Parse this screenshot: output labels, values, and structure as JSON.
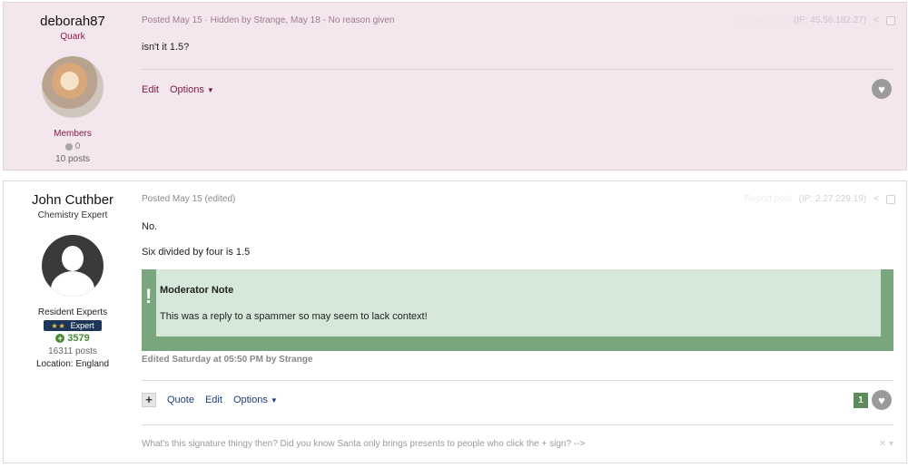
{
  "post1": {
    "author": "deborah87",
    "title": "Quark",
    "group": "Members",
    "reputation": "0",
    "post_count": "10 posts",
    "meta": "Posted May 15 · Hidden by Strange, May 18 - No reason given",
    "report_label": "Report post",
    "ip": "(IP: 45.56.182.27)",
    "body": "isn't it 1.5?",
    "edit_label": "Edit",
    "options_label": "Options"
  },
  "post2": {
    "author": "John Cuthber",
    "title": "Chemistry Expert",
    "group": "Resident Experts",
    "badge": "Expert",
    "reputation": "3579",
    "post_count": "16311 posts",
    "location": "Location: England",
    "meta": "Posted May 15 (edited)",
    "report_label": "Report post",
    "ip": "(IP: 2.27.229.19)",
    "body_line1": "No.",
    "body_line2": "Six divided by four is 1.5",
    "mod_note_title": "Moderator Note",
    "mod_note_text": "This was a reply to a spammer so may seem to lack context!",
    "edited_line": "Edited Saturday at 05:50 PM by Strange",
    "quote_label": "Quote",
    "edit_label": "Edit",
    "options_label": "Options",
    "like_count": "1",
    "signature": "What's this signature thingy then? Did you know Santa only brings presents to people who click the + sign? -->"
  },
  "colors": {
    "hidden_bg": "#f3e6ec",
    "brand": "#7b1e43",
    "link_blue": "#1d3d7a",
    "mod_green": "#7aa67d",
    "rep_green": "#4a8a36"
  }
}
